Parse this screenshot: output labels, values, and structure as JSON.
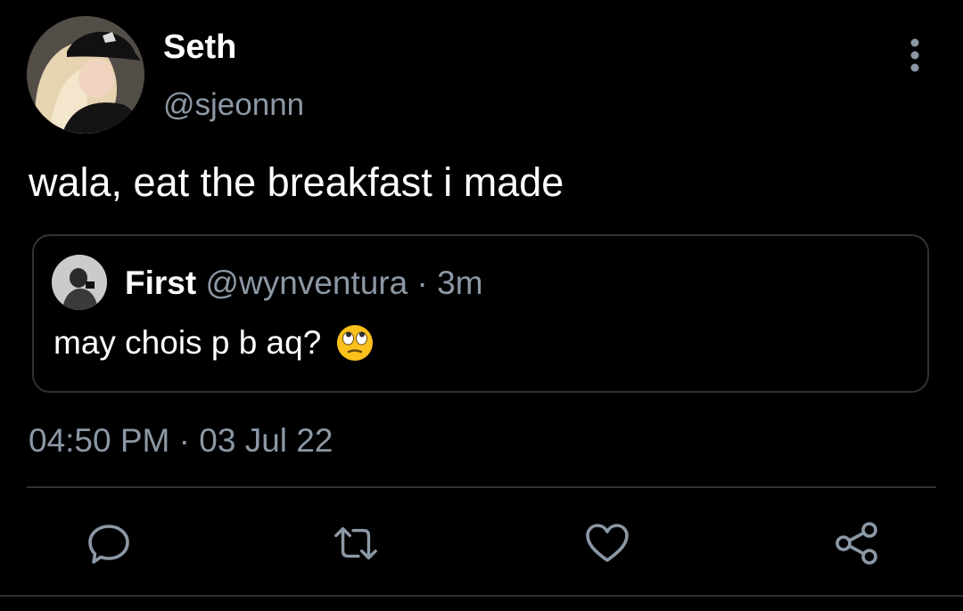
{
  "author": {
    "display_name": "Seth",
    "handle": "@sjeonnn",
    "avatar_icon": "profile-photo"
  },
  "tweet": {
    "text": "wala, eat the breakfast i made",
    "time": "04:50 PM",
    "separator": "·",
    "date": "03 Jul 22"
  },
  "quoted_tweet": {
    "display_name": "First",
    "handle": "@wynventura",
    "separator": "·",
    "age": "3m",
    "text": "may chois p b aq?",
    "emoji_icon": "face-with-rolling-eyes"
  },
  "actions": [
    {
      "name": "reply",
      "icon": "speech-bubble-icon"
    },
    {
      "name": "retweet",
      "icon": "retweet-icon"
    },
    {
      "name": "like",
      "icon": "heart-icon"
    },
    {
      "name": "share",
      "icon": "share-nodes-icon"
    }
  ],
  "colors": {
    "background": "#000000",
    "text_primary": "#ffffff",
    "text_secondary": "#8b98a5",
    "border": "#2f3336"
  }
}
